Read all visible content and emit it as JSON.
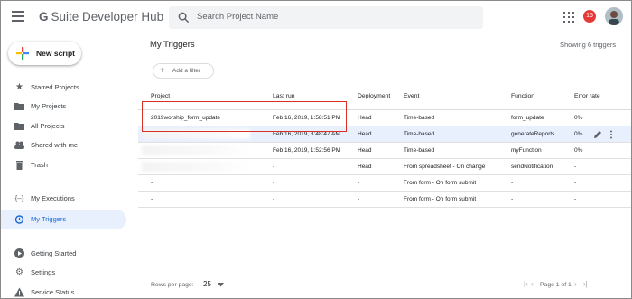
{
  "header": {
    "title": "G Suite Developer Hub",
    "logo_letter": "G",
    "logo_text": "Suite Developer Hub",
    "search_placeholder": "Search Project Name",
    "notification_count": "15"
  },
  "sidebar": {
    "new_script_label": "New script",
    "items": [
      {
        "label": "Starred Projects",
        "icon": "star-icon"
      },
      {
        "label": "My Projects",
        "icon": "folder-icon"
      },
      {
        "label": "All Projects",
        "icon": "folder-icon"
      },
      {
        "label": "Shared with me",
        "icon": "people-icon"
      },
      {
        "label": "Trash",
        "icon": "trash-icon"
      },
      {
        "label": "My Executions",
        "icon": "code-icon"
      },
      {
        "label": "My Triggers",
        "icon": "alarm-icon"
      },
      {
        "label": "Getting Started",
        "icon": "play-icon"
      },
      {
        "label": "Settings",
        "icon": "gear-icon"
      },
      {
        "label": "Service Status",
        "icon": "warning-icon"
      }
    ]
  },
  "main": {
    "title": "My Triggers",
    "showing": "Showing 6 triggers",
    "add_filter": "Add a filter",
    "columns": [
      "Project",
      "Last run",
      "Deployment",
      "Event",
      "Function",
      "Error rate"
    ],
    "rows": [
      {
        "project": "2019worship_form_update",
        "last_run": "Feb 16, 2019, 1:58:51 PM",
        "deployment": "Head",
        "event": "Time-based",
        "function": "form_update",
        "error_rate": "0%"
      },
      {
        "project": "",
        "last_run": "Feb 16, 2019, 3:48:47 AM",
        "deployment": "Head",
        "event": "Time-based",
        "function": "generateReports",
        "error_rate": "0%"
      },
      {
        "project": "",
        "last_run": "Feb 16, 2019, 1:52:56 PM",
        "deployment": "Head",
        "event": "Time-based",
        "function": "myFunction",
        "error_rate": "0%"
      },
      {
        "project": "",
        "last_run": "-",
        "deployment": "Head",
        "event": "From spreadsheet - On change",
        "function": "sendNotification",
        "error_rate": "-"
      },
      {
        "project": "-",
        "last_run": "-",
        "deployment": "-",
        "event": "From form - On form submit",
        "function": "-",
        "error_rate": "-"
      },
      {
        "project": "-",
        "last_run": "-",
        "deployment": "-",
        "event": "From form - On form submit",
        "function": "-",
        "error_rate": "-"
      }
    ]
  },
  "footer": {
    "rows_per_page_label": "Rows per page:",
    "rows_per_page_value": "25",
    "page_text": "Page 1 of 1",
    "first": "|‹",
    "prev": "‹",
    "next": "›",
    "last": "›|"
  },
  "colors": {
    "accent": "#1967d2",
    "active_bg": "#e8f0fe",
    "highlight": "#d93025"
  }
}
